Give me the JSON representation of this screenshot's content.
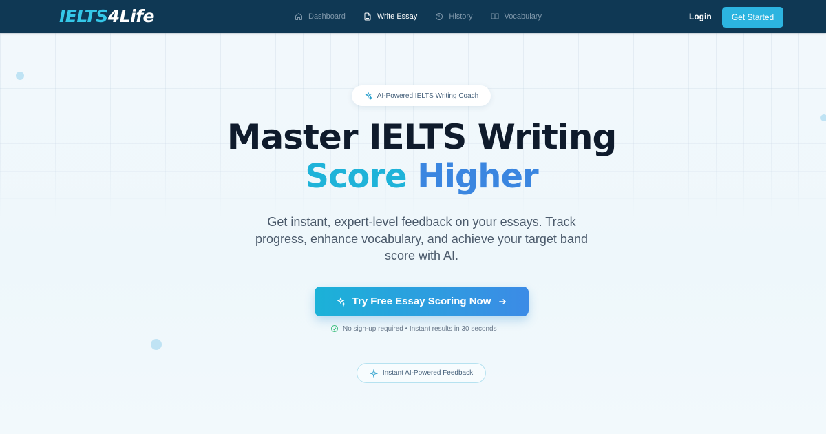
{
  "brand": {
    "logo_part1": "IELTS",
    "logo_part2": "4",
    "logo_part3": "Life"
  },
  "nav": {
    "links": [
      {
        "label": "Dashboard",
        "icon": "home-icon",
        "active": false
      },
      {
        "label": "Write Essay",
        "icon": "document-icon",
        "active": true
      },
      {
        "label": "History",
        "icon": "history-icon",
        "active": false
      },
      {
        "label": "Vocabulary",
        "icon": "book-icon",
        "active": false
      }
    ],
    "login_label": "Login",
    "get_started_label": "Get Started"
  },
  "hero": {
    "badge": "AI-Powered IELTS Writing Coach",
    "title_line1": "Master IELTS Writing",
    "title_word1": "Score",
    "title_word2": "Higher",
    "subtitle": "Get instant, expert-level feedback on your essays. Track progress, enhance vocabulary, and achieve your target band score with AI.",
    "cta_label": "Try Free Essay Scoring Now",
    "note": "No sign-up required • Instant results in 30 seconds",
    "feature_pill": "Instant AI-Powered Feedback"
  },
  "colors": {
    "nav_bg": "#0f3854",
    "accent": "#2cb4e0",
    "gradient_start": "#1bb2d8",
    "gradient_end": "#3c8be6",
    "check_green": "#3fbf7f"
  }
}
